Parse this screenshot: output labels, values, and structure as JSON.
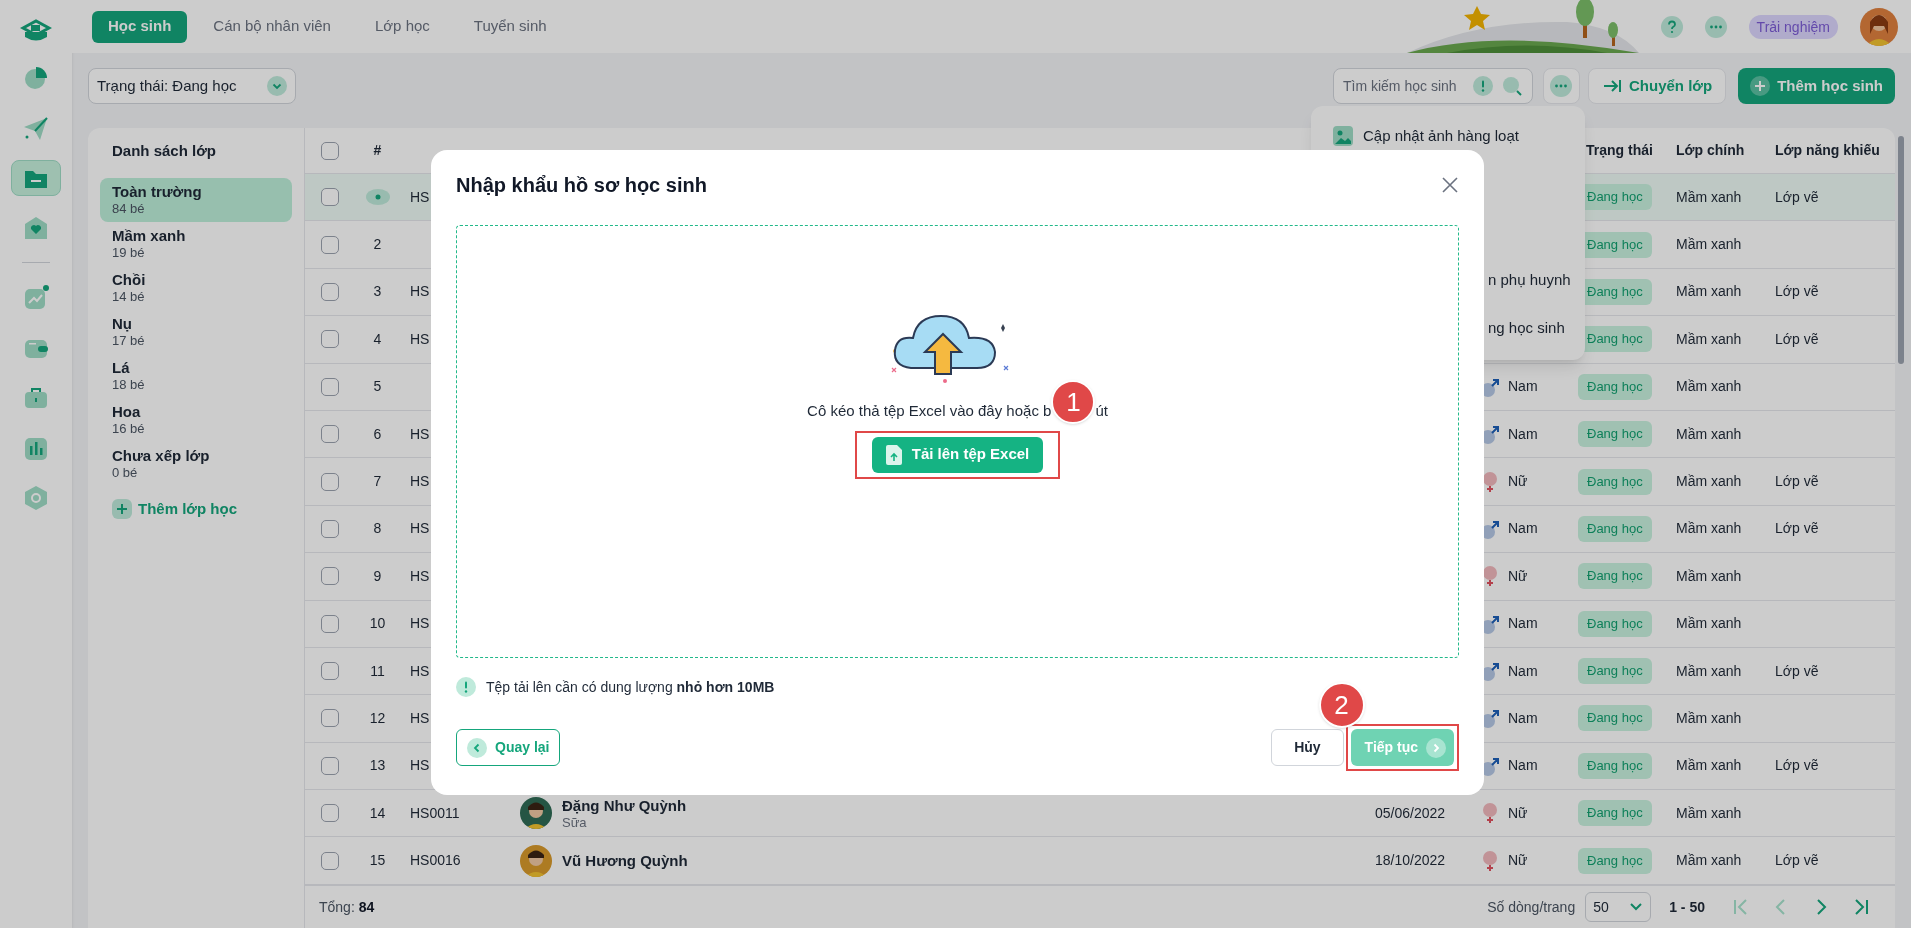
{
  "rail": [
    {
      "kind": "logo"
    },
    {
      "kind": "pie",
      "selected": false
    },
    {
      "kind": "send",
      "selected": false
    },
    {
      "kind": "folder",
      "selected": true
    },
    {
      "kind": "home",
      "selected": false
    },
    {
      "kind": "divider"
    },
    {
      "kind": "trend",
      "selected": false
    },
    {
      "kind": "wallet",
      "selected": false
    },
    {
      "kind": "briefcase",
      "selected": false
    },
    {
      "kind": "bars",
      "selected": false
    },
    {
      "kind": "settings",
      "selected": false
    }
  ],
  "top_tabs": [
    {
      "label": "Học sinh",
      "selected": true
    },
    {
      "label": "Cán bộ nhân viên",
      "selected": false
    },
    {
      "label": "Lớp học",
      "selected": false
    },
    {
      "label": "Tuyển sinh",
      "selected": false
    }
  ],
  "trial_badge": "Trải nghiệm",
  "status_filter": "Trạng thái: Đang học",
  "search": {
    "placeholder": "Tìm kiếm học sinh"
  },
  "actions": {
    "move_class": "Chuyển lớp",
    "add_student": "Thêm học sinh"
  },
  "menu": [
    {
      "label": "Cập nhật ảnh hàng loạt",
      "cut": false
    },
    {
      "label": "n phụ huynh",
      "cut": true
    },
    {
      "label": "ng học sinh",
      "cut": true
    }
  ],
  "class_list": {
    "title": "Danh sách lớp",
    "add": "Thêm lớp học",
    "items": [
      {
        "name": "Toàn trường",
        "count": "84 bé",
        "selected": true
      },
      {
        "name": "Mầm xanh",
        "count": "19 bé",
        "selected": false
      },
      {
        "name": "Chồi",
        "count": "14 bé",
        "selected": false
      },
      {
        "name": "Nụ",
        "count": "17 bé",
        "selected": false
      },
      {
        "name": "Lá",
        "count": "18 bé",
        "selected": false
      },
      {
        "name": "Hoa",
        "count": "16 bé",
        "selected": false
      },
      {
        "name": "Chưa xếp lớp",
        "count": "0 bé",
        "selected": false
      }
    ]
  },
  "table": {
    "all_checked": false,
    "columns": {
      "index": "#",
      "status": "Trạng thái",
      "main_class": "Lớp chính",
      "talent_class": "Lớp năng khiếu"
    },
    "rows": [
      {
        "selected": true,
        "hovered": true,
        "code": "HS",
        "status": "Đang học",
        "main_class": "Mầm xanh",
        "talent_class": "Lớp vẽ"
      },
      {
        "selected": false,
        "hovered": false,
        "index": "2",
        "status": "Đang học",
        "main_class": "Mầm xanh"
      },
      {
        "selected": false,
        "hovered": false,
        "index": "3",
        "code": "HS",
        "status": "Đang học",
        "main_class": "Mầm xanh",
        "talent_class": "Lớp vẽ"
      },
      {
        "selected": false,
        "hovered": false,
        "index": "4",
        "code": "HS",
        "status": "Đang học",
        "main_class": "Mầm xanh",
        "talent_class": "Lớp vẽ"
      },
      {
        "selected": false,
        "hovered": false,
        "index": "5",
        "gender": "Nam",
        "kind": "male",
        "status": "Đang học",
        "main_class": "Mầm xanh"
      },
      {
        "selected": false,
        "hovered": false,
        "index": "6",
        "code": "HS",
        "gender": "Nam",
        "kind": "male",
        "status": "Đang học",
        "main_class": "Mầm xanh"
      },
      {
        "selected": false,
        "hovered": false,
        "index": "7",
        "code": "HS",
        "gender": "Nữ",
        "kind": "female",
        "status": "Đang học",
        "main_class": "Mầm xanh",
        "talent_class": "Lớp vẽ"
      },
      {
        "selected": false,
        "hovered": false,
        "index": "8",
        "code": "HS",
        "gender": "Nam",
        "kind": "male",
        "status": "Đang học",
        "main_class": "Mầm xanh",
        "talent_class": "Lớp vẽ"
      },
      {
        "selected": false,
        "hovered": false,
        "index": "9",
        "code": "HS",
        "gender": "Nữ",
        "kind": "female",
        "status": "Đang học",
        "main_class": "Mầm xanh"
      },
      {
        "selected": false,
        "hovered": false,
        "index": "10",
        "code": "HS",
        "gender": "Nam",
        "kind": "male",
        "status": "Đang học",
        "main_class": "Mầm xanh"
      },
      {
        "selected": false,
        "hovered": false,
        "index": "11",
        "code": "HS",
        "gender": "Nam",
        "kind": "male",
        "status": "Đang học",
        "main_class": "Mầm xanh",
        "talent_class": "Lớp vẽ"
      },
      {
        "selected": false,
        "hovered": false,
        "index": "12",
        "code": "HS",
        "gender": "Nam",
        "kind": "male",
        "status": "Đang học",
        "main_class": "Mầm xanh"
      },
      {
        "selected": false,
        "hovered": false,
        "index": "13",
        "code": "HS",
        "gender": "Nam",
        "kind": "male",
        "status": "Đang học",
        "main_class": "Mầm xanh",
        "talent_class": "Lớp vẽ"
      },
      {
        "selected": false,
        "hovered": false,
        "index": "14",
        "code": "HS0011",
        "avatar": true,
        "name": "Đặng Như Quỳnh",
        "subclass": "Sữa",
        "dob": "05/06/2022",
        "gender": "Nữ",
        "kind": "female",
        "status": "Đang học",
        "main_class": "Mầm xanh"
      },
      {
        "selected": false,
        "hovered": false,
        "index": "15",
        "code": "HS0016",
        "avatar": true,
        "name": "Vũ Hương Quỳnh",
        "dob": "18/10/2022",
        "gender": "Nữ",
        "kind": "female",
        "status": "Đang học",
        "main_class": "Mầm xanh",
        "talent_class": "Lớp vẽ"
      }
    ]
  },
  "footer": {
    "total_label": "Tổng:",
    "total": "84",
    "page_size_label": "Số dòng/trang",
    "page_size": "50",
    "range": "1 - 50",
    "prev_disabled": true,
    "next_disabled": false
  },
  "modal": {
    "title": "Nhập khẩu hồ sơ học sinh",
    "hint_before": "Cô kéo thả tệp Excel vào đây hoặc b",
    "hint_after": "út",
    "upload": "Tải lên tệp Excel",
    "note": "Tệp tải lên cần có dung lượng **nhỏ hơn 10MB**",
    "back": "Quay lại",
    "cancel": "Hủy",
    "next": {
      "label": "Tiếp tục",
      "disabled": true
    }
  },
  "annotations": [
    "1",
    "2"
  ]
}
